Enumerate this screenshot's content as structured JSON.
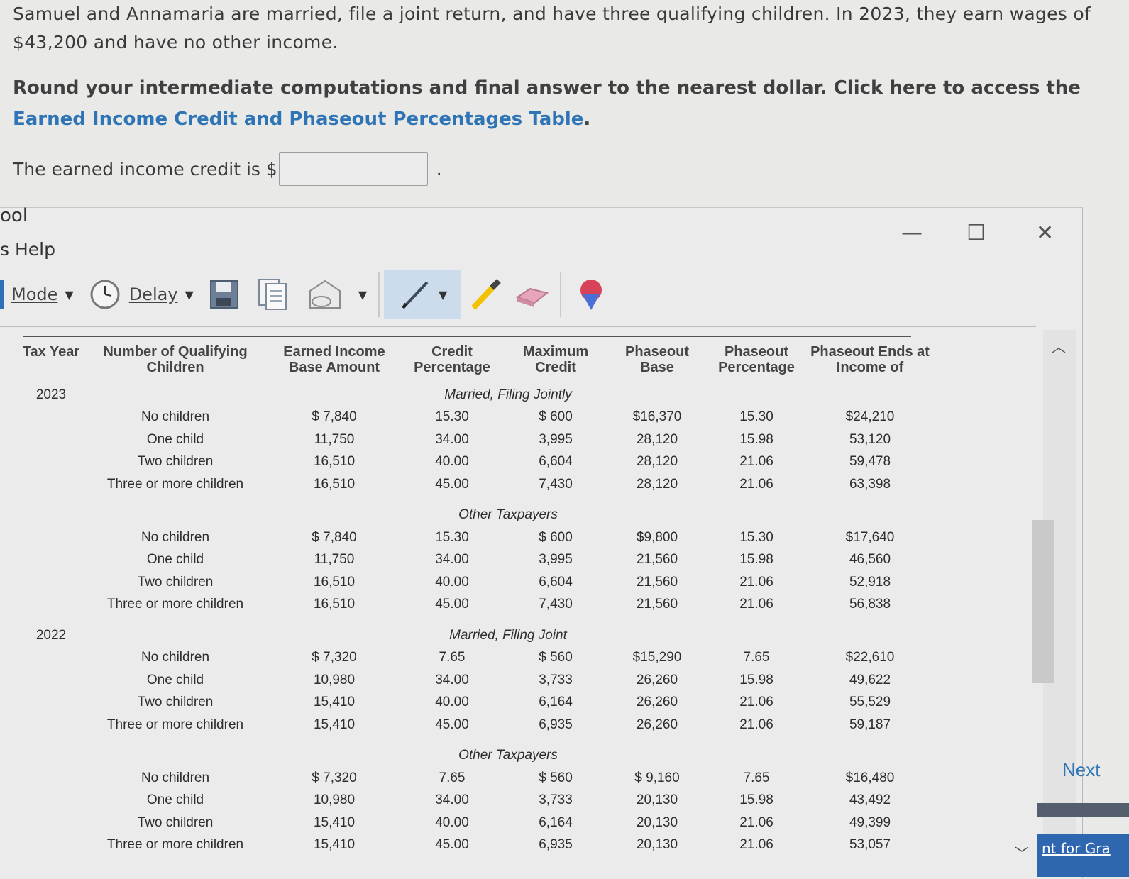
{
  "question": {
    "text": "Samuel and Annamaria are married, file a joint return, and have three qualifying children. In 2023, they earn wages of $43,200 and have no other income.",
    "instruction": "Round your intermediate computations and final answer to the nearest dollar. Click here to access the ",
    "link_text": "Earned Income Credit and Phaseout Percentages Table",
    "answer_label": "The earned income credit is $",
    "answer_value": ""
  },
  "window": {
    "title": "ool",
    "menu_help": "s  Help",
    "minimize_glyph": "—",
    "maximize_glyph": "☐",
    "close_glyph": "✕"
  },
  "toolbar": {
    "mode_label": "Mode",
    "delay_label": "Delay",
    "icons": [
      "clock-icon",
      "save-icon",
      "copy-icon",
      "send-icon",
      "pen-icon",
      "highlighter-icon",
      "eraser-icon",
      "color-picker-icon"
    ],
    "accent": "#2f6fb5"
  },
  "table": {
    "headers": {
      "year": "Tax Year",
      "kids": "Number of Qualifying Children",
      "base": "Earned Income Base Amount",
      "pct": "Credit Percentage",
      "max": "Maximum Credit",
      "pb": "Phaseout Base",
      "pp": "Phaseout Percentage",
      "end": "Phaseout Ends at Income of"
    },
    "sections": [
      {
        "year": "2023",
        "group": "Married, Filing Jointly",
        "rows": [
          {
            "kids": "No children",
            "base": "$ 7,840",
            "pct": "15.30",
            "max": "$  600",
            "pb": "$16,370",
            "pp": "15.30",
            "end": "$24,210"
          },
          {
            "kids": "One child",
            "base": "11,750",
            "pct": "34.00",
            "max": "3,995",
            "pb": "28,120",
            "pp": "15.98",
            "end": "53,120"
          },
          {
            "kids": "Two children",
            "base": "16,510",
            "pct": "40.00",
            "max": "6,604",
            "pb": "28,120",
            "pp": "21.06",
            "end": "59,478"
          },
          {
            "kids": "Three or more children",
            "base": "16,510",
            "pct": "45.00",
            "max": "7,430",
            "pb": "28,120",
            "pp": "21.06",
            "end": "63,398"
          }
        ]
      },
      {
        "year": "",
        "group": "Other Taxpayers",
        "rows": [
          {
            "kids": "No children",
            "base": "$ 7,840",
            "pct": "15.30",
            "max": "$  600",
            "pb": "$9,800",
            "pp": "15.30",
            "end": "$17,640"
          },
          {
            "kids": "One child",
            "base": "11,750",
            "pct": "34.00",
            "max": "3,995",
            "pb": "21,560",
            "pp": "15.98",
            "end": "46,560"
          },
          {
            "kids": "Two children",
            "base": "16,510",
            "pct": "40.00",
            "max": "6,604",
            "pb": "21,560",
            "pp": "21.06",
            "end": "52,918"
          },
          {
            "kids": "Three or more children",
            "base": "16,510",
            "pct": "45.00",
            "max": "7,430",
            "pb": "21,560",
            "pp": "21.06",
            "end": "56,838"
          }
        ]
      },
      {
        "year": "2022",
        "group": "Married, Filing Joint",
        "rows": [
          {
            "kids": "No children",
            "base": "$ 7,320",
            "pct": "7.65",
            "max": "$  560",
            "pb": "$15,290",
            "pp": "7.65",
            "end": "$22,610"
          },
          {
            "kids": "One child",
            "base": "10,980",
            "pct": "34.00",
            "max": "3,733",
            "pb": "26,260",
            "pp": "15.98",
            "end": "49,622"
          },
          {
            "kids": "Two children",
            "base": "15,410",
            "pct": "40.00",
            "max": "6,164",
            "pb": "26,260",
            "pp": "21.06",
            "end": "55,529"
          },
          {
            "kids": "Three or more children",
            "base": "15,410",
            "pct": "45.00",
            "max": "6,935",
            "pb": "26,260",
            "pp": "21.06",
            "end": "59,187"
          }
        ]
      },
      {
        "year": "",
        "group": "Other Taxpayers",
        "rows": [
          {
            "kids": "No children",
            "base": "$ 7,320",
            "pct": "7.65",
            "max": "$  560",
            "pb": "$ 9,160",
            "pp": "7.65",
            "end": "$16,480"
          },
          {
            "kids": "One child",
            "base": "10,980",
            "pct": "34.00",
            "max": "3,733",
            "pb": "20,130",
            "pp": "15.98",
            "end": "43,492"
          },
          {
            "kids": "Two children",
            "base": "15,410",
            "pct": "40.00",
            "max": "6,164",
            "pb": "20,130",
            "pp": "21.06",
            "end": "49,399"
          },
          {
            "kids": "Three or more children",
            "base": "15,410",
            "pct": "45.00",
            "max": "6,935",
            "pb": "20,130",
            "pp": "21.06",
            "end": "53,057"
          }
        ]
      }
    ]
  },
  "nav": {
    "next_label": "Next",
    "bottom_link": "nt for Gra"
  }
}
